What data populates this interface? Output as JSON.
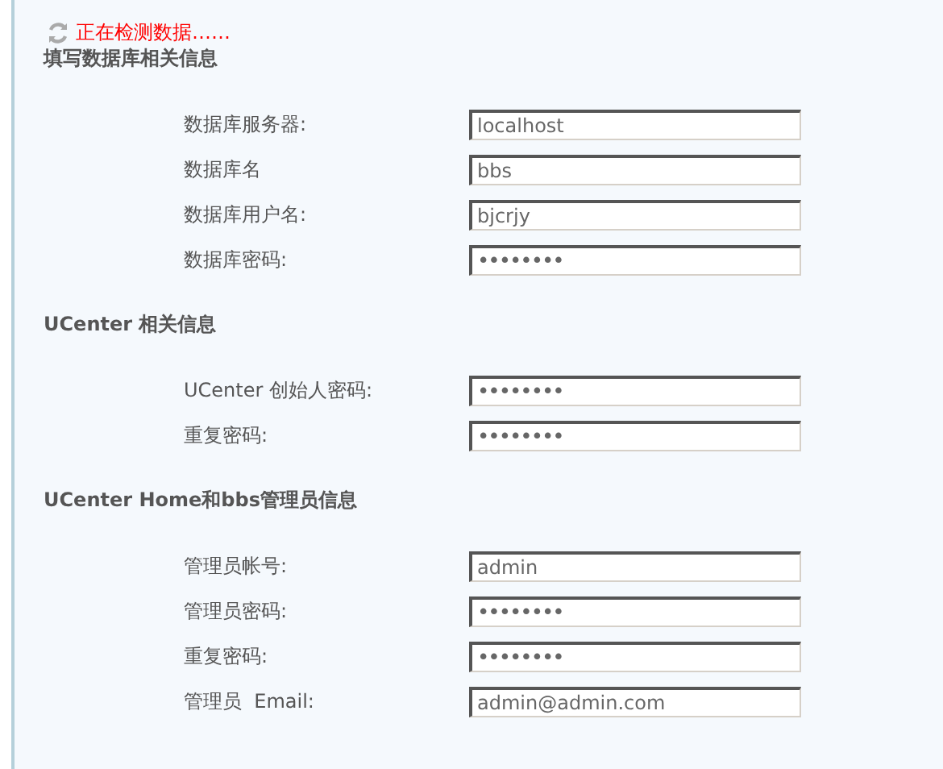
{
  "status": {
    "text": "正在检测数据……"
  },
  "sections": [
    {
      "title": "填写数据库相关信息",
      "fields": [
        {
          "label": "数据库服务器:",
          "kind": "text",
          "value": "localhost"
        },
        {
          "label": "数据库名",
          "kind": "text",
          "value": "bbs"
        },
        {
          "label": "数据库用户名:",
          "kind": "text",
          "value": "bjcrjy"
        },
        {
          "label": "数据库密码:",
          "kind": "password",
          "value": "••••••••"
        }
      ]
    },
    {
      "title": "UCenter 相关信息",
      "fields": [
        {
          "label": "UCenter 创始人密码:",
          "kind": "password",
          "value": "••••••••"
        },
        {
          "label": "重复密码:",
          "kind": "password",
          "value": "••••••••"
        }
      ]
    },
    {
      "title": "UCenter Home和bbs管理员信息",
      "fields": [
        {
          "label": "管理员帐号:",
          "kind": "text",
          "value": "admin"
        },
        {
          "label": "管理员密码:",
          "kind": "password",
          "value": "••••••••"
        },
        {
          "label": "重复密码:",
          "kind": "password",
          "value": "••••••••"
        },
        {
          "label": "管理员  Email:",
          "kind": "text",
          "value": "admin@admin.com"
        }
      ]
    }
  ]
}
